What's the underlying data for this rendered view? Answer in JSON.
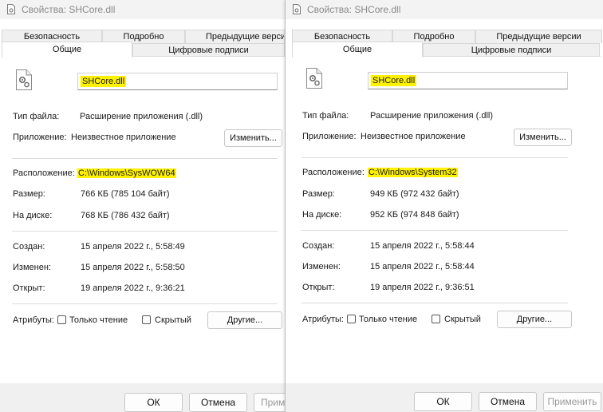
{
  "left": {
    "title": "Свойства: SHCore.dll",
    "tabs": {
      "security": "Безопасность",
      "details": "Подробно",
      "previous": "Предыдущие версии",
      "general": "Общие",
      "signatures": "Цифровые подписи"
    },
    "file_name": "SHCore.dll",
    "type_label": "Тип файла:",
    "type_value": "Расширение приложения (.dll)",
    "app_label": "Приложение:",
    "app_value": "Неизвестное приложение",
    "change_button": "Изменить...",
    "location_label": "Расположение:",
    "location_value": "C:\\Windows\\SysWOW64",
    "size_label": "Размер:",
    "size_value": "766 КБ (785 104 байт)",
    "disk_label": "На диске:",
    "disk_value": "768 КБ (786 432 байт)",
    "created_label": "Создан:",
    "created_value": "15 апреля 2022 г., 5:58:49",
    "modified_label": "Изменен:",
    "modified_value": "15 апреля 2022 г., 5:58:50",
    "opened_label": "Открыт:",
    "opened_value": "19 апреля 2022 г., 9:36:21",
    "attributes_label": "Атрибуты:",
    "readonly_label": "Только чтение",
    "hidden_label": "Скрытый",
    "other_button": "Другие...",
    "ok_button": "ОК",
    "cancel_button": "Отмена",
    "apply_button": "Примени"
  },
  "right": {
    "title": "Свойства: SHCore.dll",
    "tabs": {
      "security": "Безопасность",
      "details": "Подробно",
      "previous": "Предыдущие версии",
      "general": "Общие",
      "signatures": "Цифровые подписи"
    },
    "file_name": "SHCore.dll",
    "type_label": "Тип файла:",
    "type_value": "Расширение приложения (.dll)",
    "app_label": "Приложение:",
    "app_value": "Неизвестное приложение",
    "change_button": "Изменить...",
    "location_label": "Расположение:",
    "location_value": "C:\\Windows\\System32",
    "size_label": "Размер:",
    "size_value": "949 КБ (972 432 байт)",
    "disk_label": "На диске:",
    "disk_value": "952 КБ (974 848 байт)",
    "created_label": "Создан:",
    "created_value": "15 апреля 2022 г., 5:58:44",
    "modified_label": "Изменен:",
    "modified_value": "15 апреля 2022 г., 5:58:44",
    "opened_label": "Открыт:",
    "opened_value": "19 апреля 2022 г., 9:36:51",
    "attributes_label": "Атрибуты:",
    "readonly_label": "Только чтение",
    "hidden_label": "Скрытый",
    "other_button": "Другие...",
    "ok_button": "ОК",
    "cancel_button": "Отмена",
    "apply_button": "Применить"
  },
  "colors": {
    "highlight": "#fff200",
    "title_text": "#8a8a8a"
  },
  "icons": {
    "title": "document-gear-icon",
    "file": "dll-file-icon"
  }
}
